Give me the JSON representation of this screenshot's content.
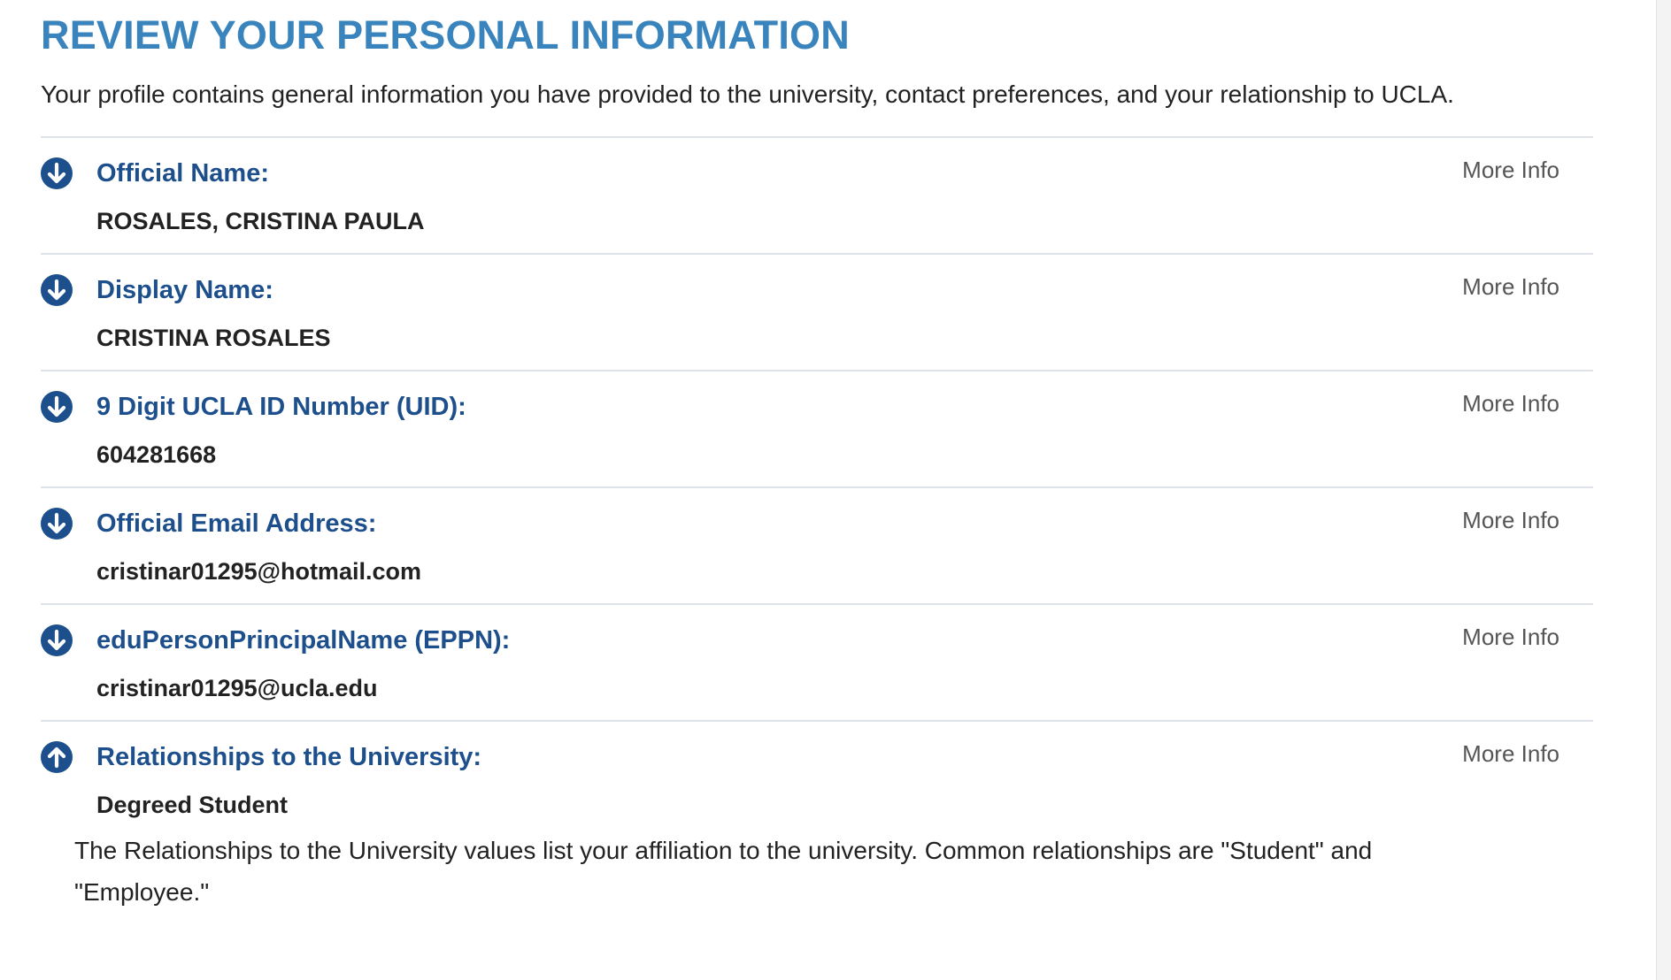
{
  "page": {
    "title": "REVIEW YOUR PERSONAL INFORMATION",
    "intro": "Your profile contains general information you have provided to the university, contact preferences, and your relationship to UCLA."
  },
  "colors": {
    "title": "#3a84bd",
    "label": "#1d4f8c",
    "divider": "#dde3e8"
  },
  "fields": [
    {
      "label": "Official Name:",
      "value": "ROSALES, CRISTINA PAULA",
      "more_info": "More Info",
      "icon": "arrow-down-circle-icon",
      "expanded": false
    },
    {
      "label": "Display Name:",
      "value": "CRISTINA ROSALES",
      "more_info": "More Info",
      "icon": "arrow-down-circle-icon",
      "expanded": false
    },
    {
      "label": "9 Digit UCLA ID Number (UID):",
      "value": "604281668",
      "more_info": "More Info",
      "icon": "arrow-down-circle-icon",
      "expanded": false
    },
    {
      "label": "Official Email Address:",
      "value": "cristinar01295@hotmail.com",
      "more_info": "More Info",
      "icon": "arrow-down-circle-icon",
      "expanded": false
    },
    {
      "label": "eduPersonPrincipalName (EPPN):",
      "value": "cristinar01295@ucla.edu",
      "more_info": "More Info",
      "icon": "arrow-down-circle-icon",
      "expanded": false
    },
    {
      "label": "Relationships to the University:",
      "value": "Degreed Student",
      "more_info": "More Info",
      "icon": "arrow-up-circle-icon",
      "expanded": true,
      "description": "The Relationships to the University values list your affiliation to the university. Common relationships are \"Student\" and \"Employee.\""
    }
  ]
}
